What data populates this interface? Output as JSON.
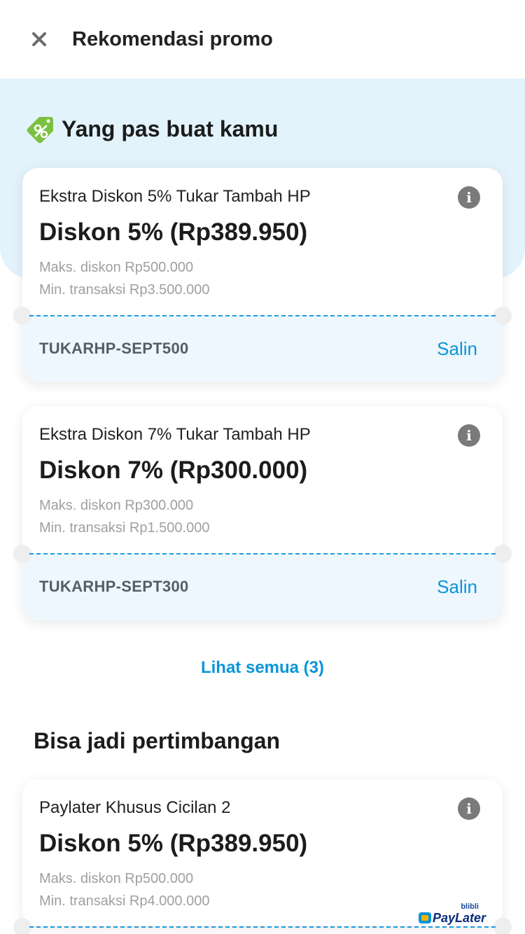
{
  "header": {
    "close_icon": "close-icon",
    "title": "Rekomendasi promo"
  },
  "recommended": {
    "title": "Yang pas buat kamu",
    "icon": "discount-tag-icon",
    "promos": [
      {
        "name": "Ekstra Diskon 5% Tukar Tambah HP",
        "amount": "Diskon 5% (Rp389.950)",
        "max_discount": "Maks. diskon Rp500.000",
        "min_transaction": "Min. transaksi Rp3.500.000",
        "code": "TUKARHP-SEPT500",
        "copy_label": "Salin"
      },
      {
        "name": "Ekstra Diskon 7% Tukar Tambah HP",
        "amount": "Diskon 7% (Rp300.000)",
        "max_discount": "Maks. diskon Rp300.000",
        "min_transaction": "Min. transaksi Rp1.500.000",
        "code": "TUKARHP-SEPT300",
        "copy_label": "Salin"
      }
    ],
    "see_all_label": "Lihat semua (3)"
  },
  "considerations": {
    "title": "Bisa jadi pertimbangan",
    "promos": [
      {
        "name": "Paylater Khusus Cicilan 2",
        "amount": "Diskon 5% (Rp389.950)",
        "max_discount": "Maks. diskon Rp500.000",
        "min_transaction": "Min. transaksi Rp4.000.000",
        "badge_small": "blibli",
        "badge_big": "PayLater"
      }
    ]
  },
  "colors": {
    "accent": "#0a95d8",
    "hero_bg": "#e3f3fc",
    "tag_green": "#7cc142"
  }
}
